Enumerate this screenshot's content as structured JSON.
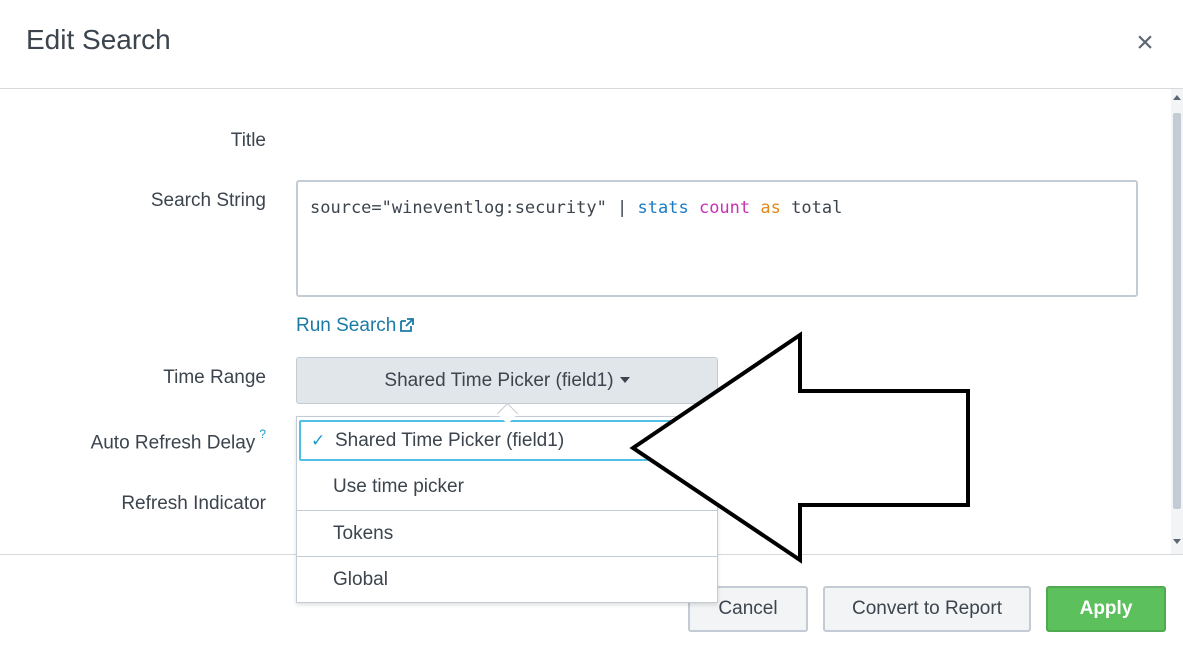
{
  "dialog": {
    "title": "Edit Search",
    "close_glyph": "×"
  },
  "form": {
    "title_label": "Title",
    "search_string_label": "Search String",
    "search_string": {
      "source_part": "source=\"wineventlog:security\" | ",
      "command": "stats",
      "function": "count",
      "keyword": "as",
      "field": "total"
    },
    "run_search_label": "Run Search",
    "time_range_label": "Time Range",
    "time_range_value": "Shared Time Picker (field1)",
    "auto_refresh_label": "Auto Refresh Delay",
    "auto_refresh_help": "?",
    "refresh_indicator_label": "Refresh Indicator"
  },
  "time_range_dropdown": {
    "options": [
      {
        "label": "Shared Time Picker (field1)",
        "selected": true
      },
      {
        "label": "Use time picker",
        "selected": false
      },
      {
        "label": "Tokens",
        "selected": false
      },
      {
        "label": "Global",
        "selected": false
      }
    ],
    "check_glyph": "✓"
  },
  "footer": {
    "cancel_label": "Cancel",
    "convert_label": "Convert to Report",
    "apply_label": "Apply"
  },
  "colors": {
    "accent_blue": "#1a9ac8",
    "link_blue": "#1a7ba6",
    "apply_green": "#5cc05c",
    "spl_command": "#1b7bc4",
    "spl_function": "#c832b8",
    "spl_keyword": "#e1891d"
  },
  "icons": {
    "close": "close-icon",
    "external_link": "external-link-icon",
    "dropdown_caret": "caret-down-icon",
    "checkmark": "checkmark-icon",
    "annotation": "arrow-left-icon"
  }
}
